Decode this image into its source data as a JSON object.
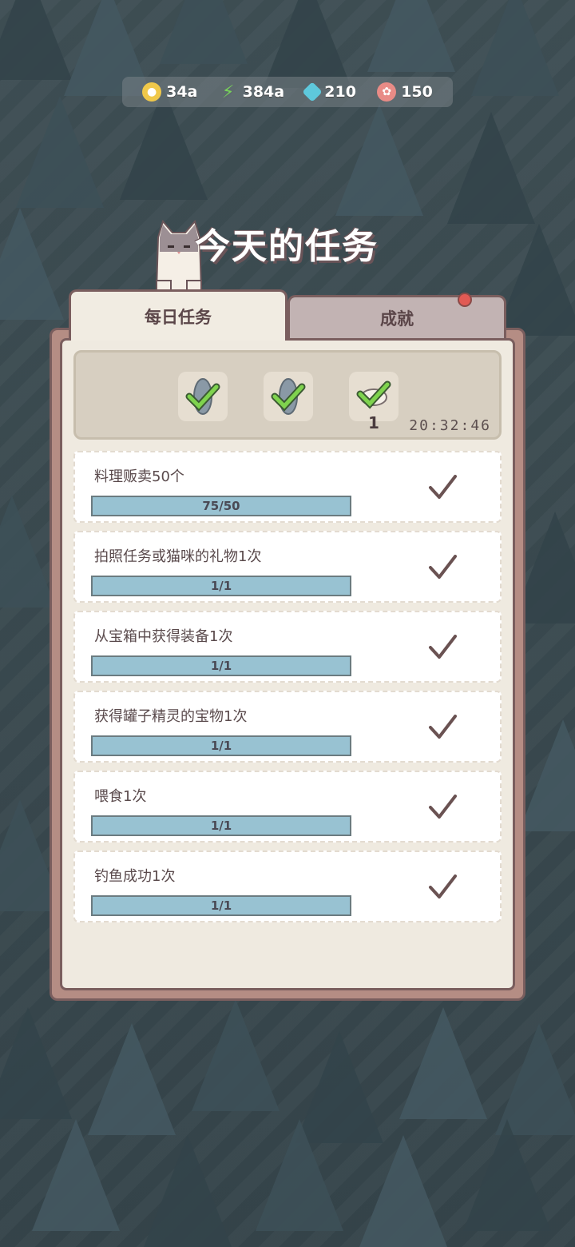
{
  "resources": [
    {
      "icon": "coin-icon",
      "value": "34a",
      "color": "#f0c84a"
    },
    {
      "icon": "lightning-icon",
      "value": "384a",
      "color": "#78d35a"
    },
    {
      "icon": "gem-icon",
      "value": "210",
      "color": "#5ec8dc"
    },
    {
      "icon": "fish-cake-icon",
      "value": "150",
      "color": "#e88b86"
    }
  ],
  "title": "今天的任务",
  "tabs": {
    "daily": "每日任务",
    "achievements": "成就"
  },
  "rewards": {
    "count": "1",
    "timer": "20:32:46"
  },
  "tasks": [
    {
      "name": "料理贩卖50个",
      "progress": "75/50"
    },
    {
      "name": "拍照任务或猫咪的礼物1次",
      "progress": "1/1"
    },
    {
      "name": "从宝箱中获得装备1次",
      "progress": "1/1"
    },
    {
      "name": "获得罐子精灵的宝物1次",
      "progress": "1/1"
    },
    {
      "name": "喂食1次",
      "progress": "1/1"
    },
    {
      "name": "钓鱼成功1次",
      "progress": "1/1"
    }
  ],
  "colors": {
    "panel_border": "#7a5e5e",
    "progress_fill": "#98c2d2",
    "check": "#6a5252",
    "notification_dot": "#e15a54"
  }
}
